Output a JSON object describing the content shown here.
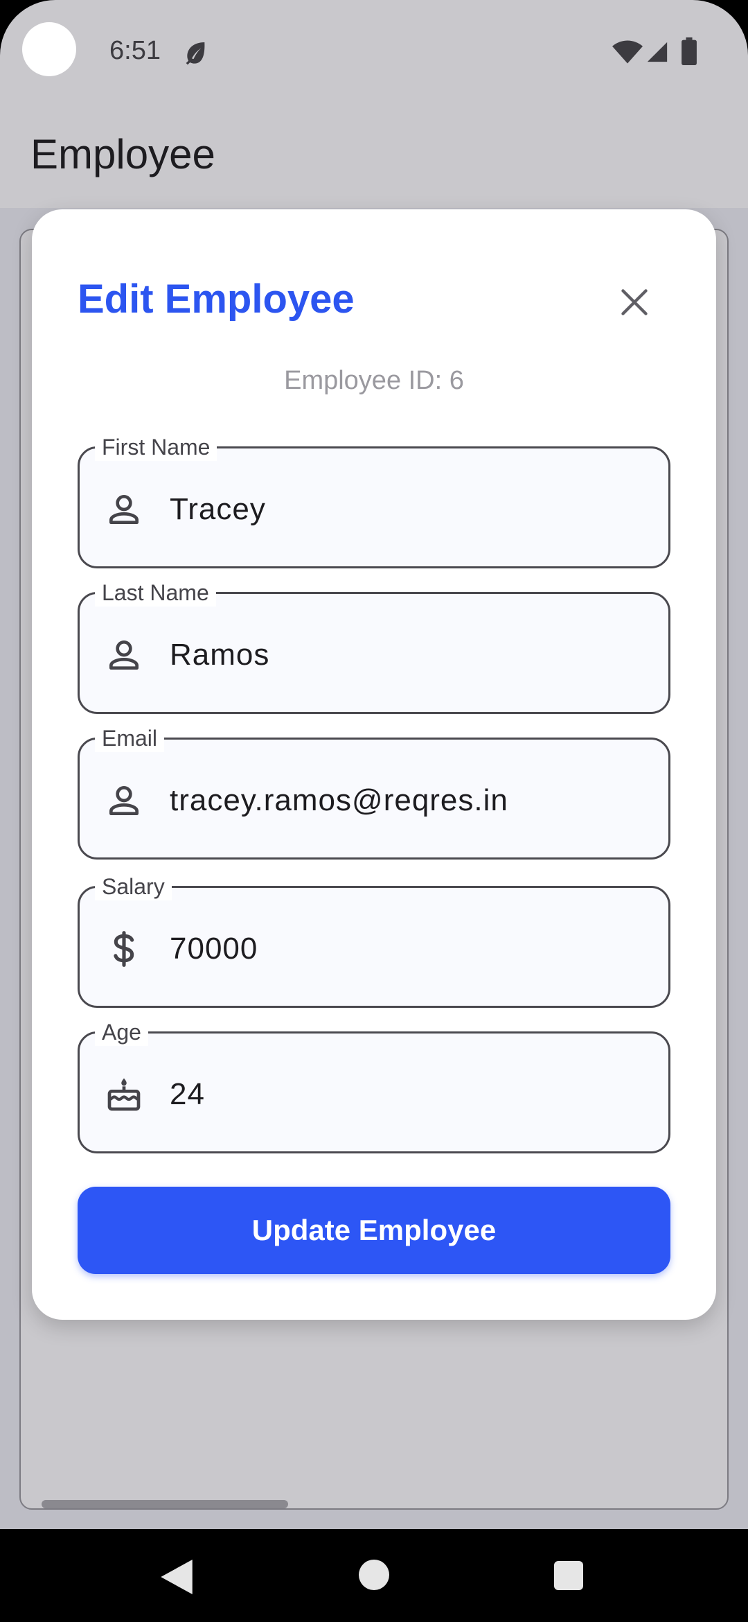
{
  "status_bar": {
    "time": "6:51"
  },
  "app_bar": {
    "title": "Employee"
  },
  "dialog": {
    "title": "Edit Employee",
    "employee_id_text": "Employee ID: 6",
    "fields": {
      "first_name": {
        "label": "First Name",
        "value": "Tracey",
        "icon": "person-icon"
      },
      "last_name": {
        "label": "Last Name",
        "value": "Ramos",
        "icon": "person-icon"
      },
      "email": {
        "label": "Email",
        "value": "tracey.ramos@reqres.in",
        "icon": "person-icon"
      },
      "salary": {
        "label": "Salary",
        "value": "70000",
        "icon": "dollar-icon"
      },
      "age": {
        "label": "Age",
        "value": "24",
        "icon": "cake-icon"
      }
    },
    "update_button_label": "Update Employee",
    "accent_color": "#2c55f0"
  }
}
